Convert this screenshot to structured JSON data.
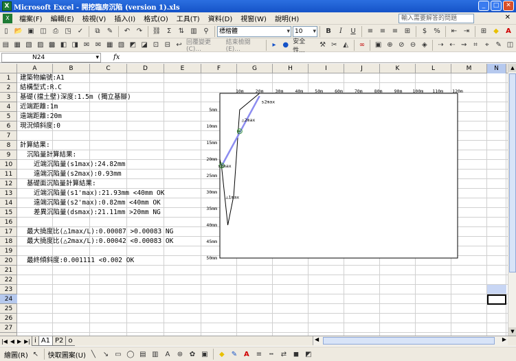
{
  "window": {
    "title": "Microsoft Excel - 開挖臨房沉陷 (version 1).xls"
  },
  "menu": {
    "items": [
      "檔案(F)",
      "編輯(E)",
      "檢視(V)",
      "插入(I)",
      "格式(O)",
      "工具(T)",
      "資料(D)",
      "視窗(W)",
      "說明(H)"
    ],
    "help_placeholder": "輸入需要解答的問題"
  },
  "toolbar": {
    "font_name": "標楷體",
    "font_size": "10",
    "review_label": "回覆變更(C)...",
    "end_review_label": "結束檢閱(E)...",
    "security_label": "安全性..."
  },
  "formula_bar": {
    "name_box": "N24",
    "fx": "fx",
    "formula": ""
  },
  "columns": [
    "A",
    "B",
    "C",
    "D",
    "E",
    "F",
    "G",
    "H",
    "I",
    "J",
    "K",
    "L",
    "M",
    "N"
  ],
  "rows": [
    "1",
    "2",
    "3",
    "4",
    "5",
    "6",
    "7",
    "8",
    "9",
    "10",
    "11",
    "12",
    "13",
    "14",
    "15",
    "16",
    "17",
    "18",
    "19",
    "20",
    "21",
    "22",
    "23",
    "24",
    "25",
    "26",
    "27"
  ],
  "selected_cell": "N24",
  "cells": [
    {
      "row": 1,
      "indent": 0,
      "text": "建築物編號:A1"
    },
    {
      "row": 2,
      "indent": 0,
      "text": "結構型式:R.C"
    },
    {
      "row": 3,
      "indent": 0,
      "text": "基礎(擋土壁)深度:1.5m (獨立基腳)"
    },
    {
      "row": 4,
      "indent": 0,
      "text": "近端距離:1m"
    },
    {
      "row": 5,
      "indent": 0,
      "text": "遠端距離:20m"
    },
    {
      "row": 6,
      "indent": 0,
      "text": "現況傾斜度:0"
    },
    {
      "row": 8,
      "indent": 0,
      "text": "計算結果:"
    },
    {
      "row": 9,
      "indent": 1,
      "text": "沉陷量計算結果:"
    },
    {
      "row": 10,
      "indent": 2,
      "text": "近端沉陷量(s1max):24.82mm"
    },
    {
      "row": 11,
      "indent": 2,
      "text": "遠端沉陷量(s2max):0.93mm"
    },
    {
      "row": 12,
      "indent": 1,
      "text": "基礎面沉陷量計算結果:"
    },
    {
      "row": 13,
      "indent": 2,
      "text": "近端沉陷量(s1'max):21.93mm <40mm OK"
    },
    {
      "row": 14,
      "indent": 2,
      "text": "遠端沉陷量(s2'max):0.82mm <40mm OK"
    },
    {
      "row": 15,
      "indent": 2,
      "text": "差異沉陷量(dsmax):21.11mm >20mm NG"
    },
    {
      "row": 17,
      "indent": 1,
      "text": "最大撓度比(△1max/L):0.00087 >0.00083 NG"
    },
    {
      "row": 18,
      "indent": 1,
      "text": "最大撓度比(△2max/L):0.00042 <0.00083 OK"
    },
    {
      "row": 20,
      "indent": 1,
      "text": "最終傾斜度:0.001111 <0.002 OK"
    }
  ],
  "chart_data": {
    "type": "line",
    "x_ticks": [
      "10m",
      "20m",
      "30m",
      "40m",
      "50m",
      "60m",
      "70m",
      "80m",
      "90m",
      "100m",
      "110m",
      "120m"
    ],
    "y_ticks": [
      "5mm",
      "10mm",
      "15mm",
      "20mm",
      "25mm",
      "30mm",
      "35mm",
      "40mm",
      "45mm",
      "50mm"
    ],
    "xlim": [
      0,
      120
    ],
    "ylim": [
      0,
      50
    ],
    "settlement_profile": [
      {
        "x": 0,
        "y": 20
      },
      {
        "x": 1,
        "y": 23
      },
      {
        "x": 4,
        "y": 40
      },
      {
        "x": 7,
        "y": 31
      },
      {
        "x": 10,
        "y": 5
      },
      {
        "x": 20,
        "y": 0
      }
    ],
    "building_line": [
      {
        "x": 1,
        "y": 21.93
      },
      {
        "x": 20,
        "y": 0.82
      }
    ],
    "markers": [
      {
        "x": 1,
        "y": 21.93
      },
      {
        "x": 10,
        "y": 11.5
      }
    ],
    "annotations": [
      {
        "text": "s2max",
        "x": 21,
        "y": 3
      },
      {
        "text": "△2max",
        "x": 11,
        "y": 8.5
      },
      {
        "text": "s1max",
        "x": -1,
        "y": 22.5
      },
      {
        "text": "△1max",
        "x": 3,
        "y": 32
      }
    ]
  },
  "sheet_tabs": [
    "i",
    "A1",
    "P2",
    "o"
  ],
  "active_tab": "A1",
  "draw_toolbar": {
    "draw_label": "繪圖(R)",
    "autoshape_label": "快取圖案(U)"
  }
}
